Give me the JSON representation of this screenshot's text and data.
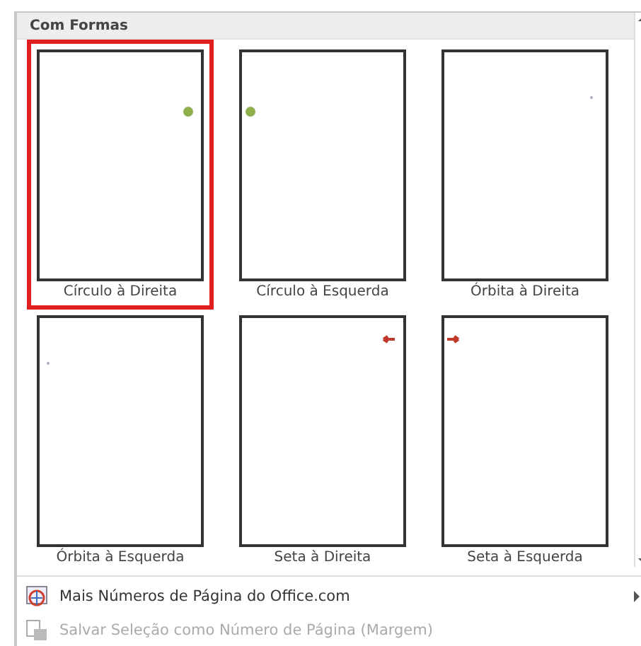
{
  "section_title": "Com Formas",
  "items": [
    {
      "label": "Círculo à Direita",
      "kind": "circle-right",
      "selected": true
    },
    {
      "label": "Círculo à Esquerda",
      "kind": "circle-left",
      "selected": false
    },
    {
      "label": "Órbita à Direita",
      "kind": "orbit-right",
      "selected": false
    },
    {
      "label": "Órbita à Esquerda",
      "kind": "orbit-left",
      "selected": false
    },
    {
      "label": "Seta à Direita",
      "kind": "arrow-right",
      "selected": false
    },
    {
      "label": "Seta à Esquerda",
      "kind": "arrow-left",
      "selected": false
    }
  ],
  "menu": [
    {
      "label": "Mais Números de Página do Office.com",
      "kind": "web",
      "disabled": false,
      "submenu": true
    },
    {
      "label": "Salvar Seleção como Número de Página (Margem)",
      "kind": "save",
      "disabled": true,
      "submenu": false
    }
  ]
}
